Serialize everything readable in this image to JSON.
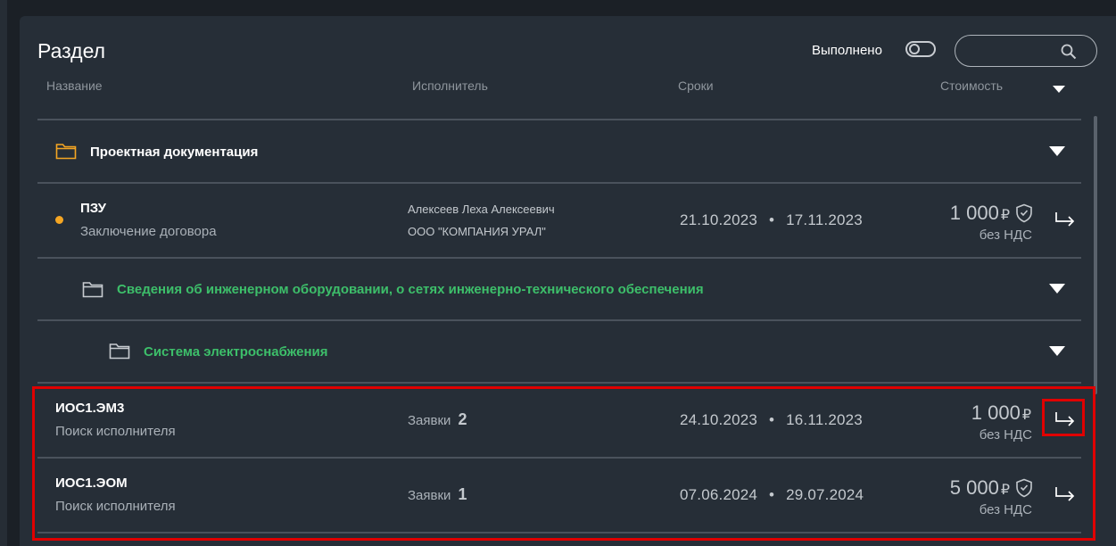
{
  "header": {
    "title": "Раздел",
    "done_label": "Выполнено",
    "search_placeholder": ""
  },
  "columns": [
    "Название",
    "Исполнитель",
    "Сроки",
    "Стоимость"
  ],
  "groups": [
    {
      "label": "Проектная документация",
      "color": "#ffffff"
    },
    {
      "label": "Сведения об инженерном оборудовании, о сетях инженерно-технического обеспечения",
      "color": "#3dbf6a"
    },
    {
      "label": "Система электроснабжения",
      "color": "#3dbf6a"
    }
  ],
  "rows": [
    {
      "code": "ПЗУ",
      "status": "Заключение договора",
      "person": "Алексеев Леха Алексеевич",
      "company": "ООО \"КОМПАНИЯ УРАЛ\"",
      "start": "21.10.2023",
      "sep": "•",
      "end": "17.11.2023",
      "amount": "1 000",
      "currency": "₽",
      "vat": "без НДС"
    },
    {
      "code": "ИОС1.ЭМ3",
      "status": "Поиск исполнителя",
      "requests_label": "Заявки",
      "requests_count": "2",
      "start": "24.10.2023",
      "sep": "•",
      "end": "16.11.2023",
      "amount": "1 000",
      "currency": "₽",
      "vat": "без НДС"
    },
    {
      "code": "ИОС1.ЭОМ",
      "status": "Поиск исполнителя",
      "requests_label": "Заявки",
      "requests_count": "1",
      "start": "07.06.2024",
      "sep": "•",
      "end": "29.07.2024",
      "amount": "5 000",
      "currency": "₽",
      "vat": "без НДС"
    }
  ],
  "colors": {
    "panel": "#262e37",
    "background": "#1b2026",
    "green": "#3dbf6a",
    "orange": "#f5a623",
    "highlight": "#e00000"
  }
}
